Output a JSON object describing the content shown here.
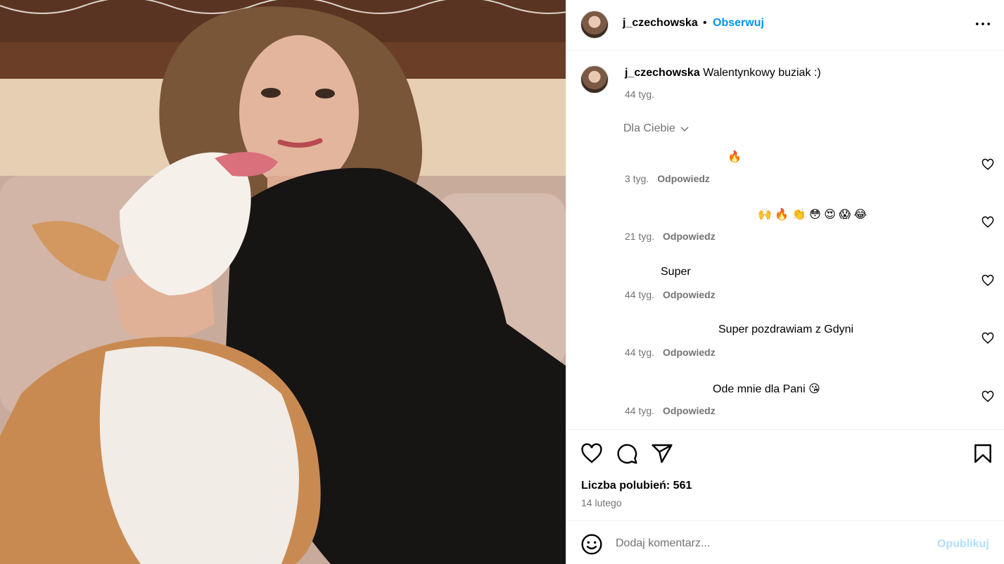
{
  "post": {
    "photo_alt": "Kobieta z psem corgi liżącym jej policzek na kanapie"
  },
  "header": {
    "username": "j_czechowska",
    "separator": "•",
    "follow_label": "Obserwuj",
    "more_icon": "more-horizontal-icon"
  },
  "caption": {
    "username": "j_czechowska",
    "text": "Walentynkowy buziak :)",
    "time": "44 tyg."
  },
  "for_you": {
    "label": "Dla Ciebie",
    "icon": "chevron-down-icon"
  },
  "comments": [
    {
      "text": "🔥",
      "time": "3 tyg.",
      "reply_label": "Odpowiedz"
    },
    {
      "text": "🙌 🔥 👏 😳 😍 😱 😂",
      "time": "21 tyg.",
      "reply_label": "Odpowiedz"
    },
    {
      "text": "Super",
      "time": "44 tyg.",
      "reply_label": "Odpowiedz"
    },
    {
      "text": "Super pozdrawiam z Gdyni",
      "time": "44 tyg.",
      "reply_label": "Odpowiedz"
    },
    {
      "text": "Ode mnie dla Pani 😘",
      "time": "44 tyg.",
      "reply_label": "Odpowiedz"
    }
  ],
  "actions": {
    "like_icon": "heart-icon",
    "comment_icon": "comment-icon",
    "share_icon": "send-icon",
    "save_icon": "bookmark-icon",
    "likes_text": "Liczba polubień: 561",
    "date": "14 lutego"
  },
  "composer": {
    "emoji_icon": "smiley-icon",
    "placeholder": "Dodaj komentarz...",
    "value": "",
    "publish_label": "Opublikuj"
  },
  "colors": {
    "accent": "#0095f6",
    "publish_disabled": "#b2dffc",
    "secondary_text": "#737373",
    "divider": "#efefef"
  }
}
